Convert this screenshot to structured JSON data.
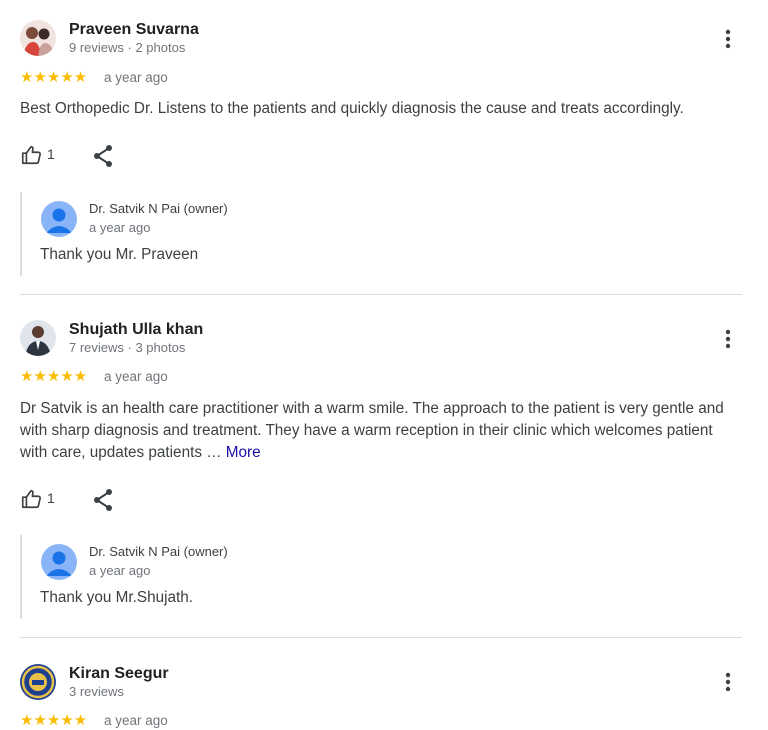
{
  "reviews": [
    {
      "author": "Praveen Suvarna",
      "meta": "9 reviews · 2 photos",
      "stars": "★★★★★",
      "date": "a year ago",
      "text": "Best Orthopedic Dr. Listens to the patients and quickly diagnosis the cause and treats accordingly.",
      "more": "",
      "likes": "1",
      "reply": {
        "author": "Dr. Satvik N Pai (owner)",
        "date": "a year ago",
        "text": "Thank you Mr. Praveen"
      }
    },
    {
      "author": "Shujath Ulla khan",
      "meta": "7 reviews · 3 photos",
      "stars": "★★★★★",
      "date": "a year ago",
      "text": "Dr Satvik is an health care practitioner with a warm smile. The approach to the patient is very gentle and with sharp diagnosis and treatment. They have a warm reception in their clinic which welcomes patient with care, updates patients …",
      "more": "More",
      "likes": "1",
      "reply": {
        "author": "Dr. Satvik N Pai (owner)",
        "date": "a year ago",
        "text": "Thank you Mr.Shujath."
      }
    },
    {
      "author": "Kiran Seegur",
      "meta": "3 reviews",
      "stars": "★★★★★",
      "date": "a year ago"
    }
  ],
  "colors": {
    "star": "#fbbc04",
    "link": "#1a0dab",
    "divider": "#dadce0",
    "owner_avatar": "#8ab4f8"
  },
  "icons": [
    "kebab-menu-icon",
    "thumbs-up-icon",
    "share-icon",
    "person-icon"
  ]
}
